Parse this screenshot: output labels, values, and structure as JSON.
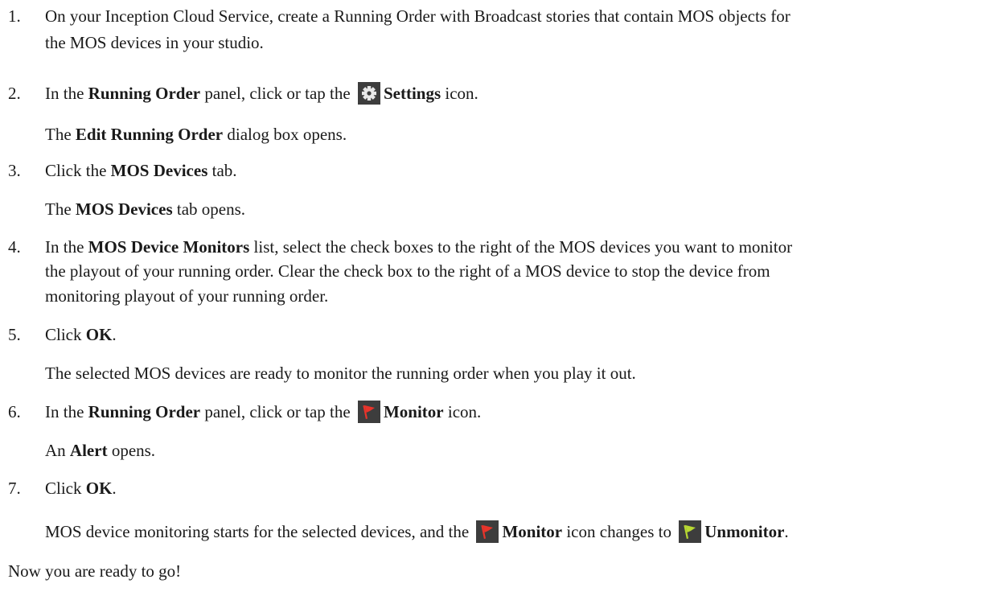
{
  "steps": [
    {
      "num": "1.",
      "line1": "On your Inception Cloud Service, create a Running Order with Broadcast stories that contain MOS objects for",
      "line2": "the MOS devices in your studio."
    },
    {
      "num": "2.",
      "pre": "In the ",
      "bold1": "Running Order",
      "mid": " panel, click or tap the ",
      "bold2": "Settings",
      "post": " icon.",
      "sub_pre": "The ",
      "sub_bold": "Edit Running Order",
      "sub_post": " dialog box opens."
    },
    {
      "num": "3.",
      "pre": "Click the ",
      "bold1": "MOS Devices",
      "post": " tab.",
      "sub_pre": "The ",
      "sub_bold": "MOS Devices",
      "sub_post": " tab opens."
    },
    {
      "num": "4.",
      "pre": "In the ",
      "bold1": "MOS Device Monitors",
      "line1_post": " list, select the check boxes to the right of the MOS devices you want to monitor",
      "line2": "the playout of your running order. Clear the check box to the right of a MOS device to stop the device from",
      "line3": "monitoring playout of your running order."
    },
    {
      "num": "5.",
      "pre": "Click ",
      "bold1": "OK",
      "post": ".",
      "sub": "The selected MOS devices are ready to monitor the running order when you play it out."
    },
    {
      "num": "6.",
      "pre": "In the ",
      "bold1": "Running Order",
      "mid": " panel, click or tap the ",
      "bold2": "Monitor",
      "post": " icon.",
      "sub_pre": "An ",
      "sub_bold": "Alert",
      "sub_post": " opens."
    },
    {
      "num": "7.",
      "pre": "Click ",
      "bold1": "OK",
      "post": ".",
      "sub_pre": "MOS device monitoring starts for the selected devices, and the ",
      "sub_bold1": "Monitor",
      "sub_mid": " icon changes to ",
      "sub_bold2": "Unmonitor",
      "sub_post": "."
    }
  ],
  "closing": "Now you are ready to go!",
  "icons": {
    "settings": "gear-icon",
    "monitor": "red-flag-icon",
    "unmonitor": "green-flag-icon"
  },
  "colors": {
    "icon_bg": "#3d3d3d",
    "flag_red": "#e8342b",
    "flag_green": "#b8d832",
    "text": "#1a1a1a"
  }
}
